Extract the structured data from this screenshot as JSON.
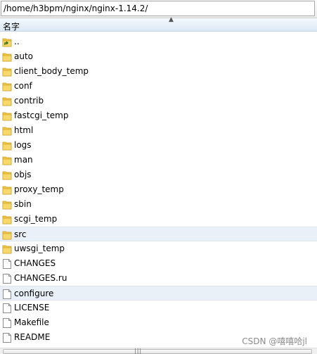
{
  "path": "/home/h3bpm/nginx/nginx-1.14.2/",
  "columns": {
    "name": "名字",
    "sort_icon": "sort-ascending-icon"
  },
  "items": [
    {
      "name": "..",
      "type": "parent"
    },
    {
      "name": "auto",
      "type": "folder"
    },
    {
      "name": "client_body_temp",
      "type": "folder"
    },
    {
      "name": "conf",
      "type": "folder"
    },
    {
      "name": "contrib",
      "type": "folder"
    },
    {
      "name": "fastcgi_temp",
      "type": "folder"
    },
    {
      "name": "html",
      "type": "folder"
    },
    {
      "name": "logs",
      "type": "folder"
    },
    {
      "name": "man",
      "type": "folder"
    },
    {
      "name": "objs",
      "type": "folder"
    },
    {
      "name": "proxy_temp",
      "type": "folder"
    },
    {
      "name": "sbin",
      "type": "folder"
    },
    {
      "name": "scgi_temp",
      "type": "folder"
    },
    {
      "name": "src",
      "type": "folder",
      "highlighted": true
    },
    {
      "name": "uwsgi_temp",
      "type": "folder"
    },
    {
      "name": "CHANGES",
      "type": "file"
    },
    {
      "name": "CHANGES.ru",
      "type": "file"
    },
    {
      "name": "configure",
      "type": "file",
      "highlighted": true
    },
    {
      "name": "LICENSE",
      "type": "file"
    },
    {
      "name": "Makefile",
      "type": "file"
    },
    {
      "name": "README",
      "type": "file"
    }
  ],
  "watermark": "CSDN @嘻嘻哈jl",
  "colors": {
    "folder": "#f2c744",
    "highlight": "#e9f0f7",
    "header": "#dce9f5"
  }
}
